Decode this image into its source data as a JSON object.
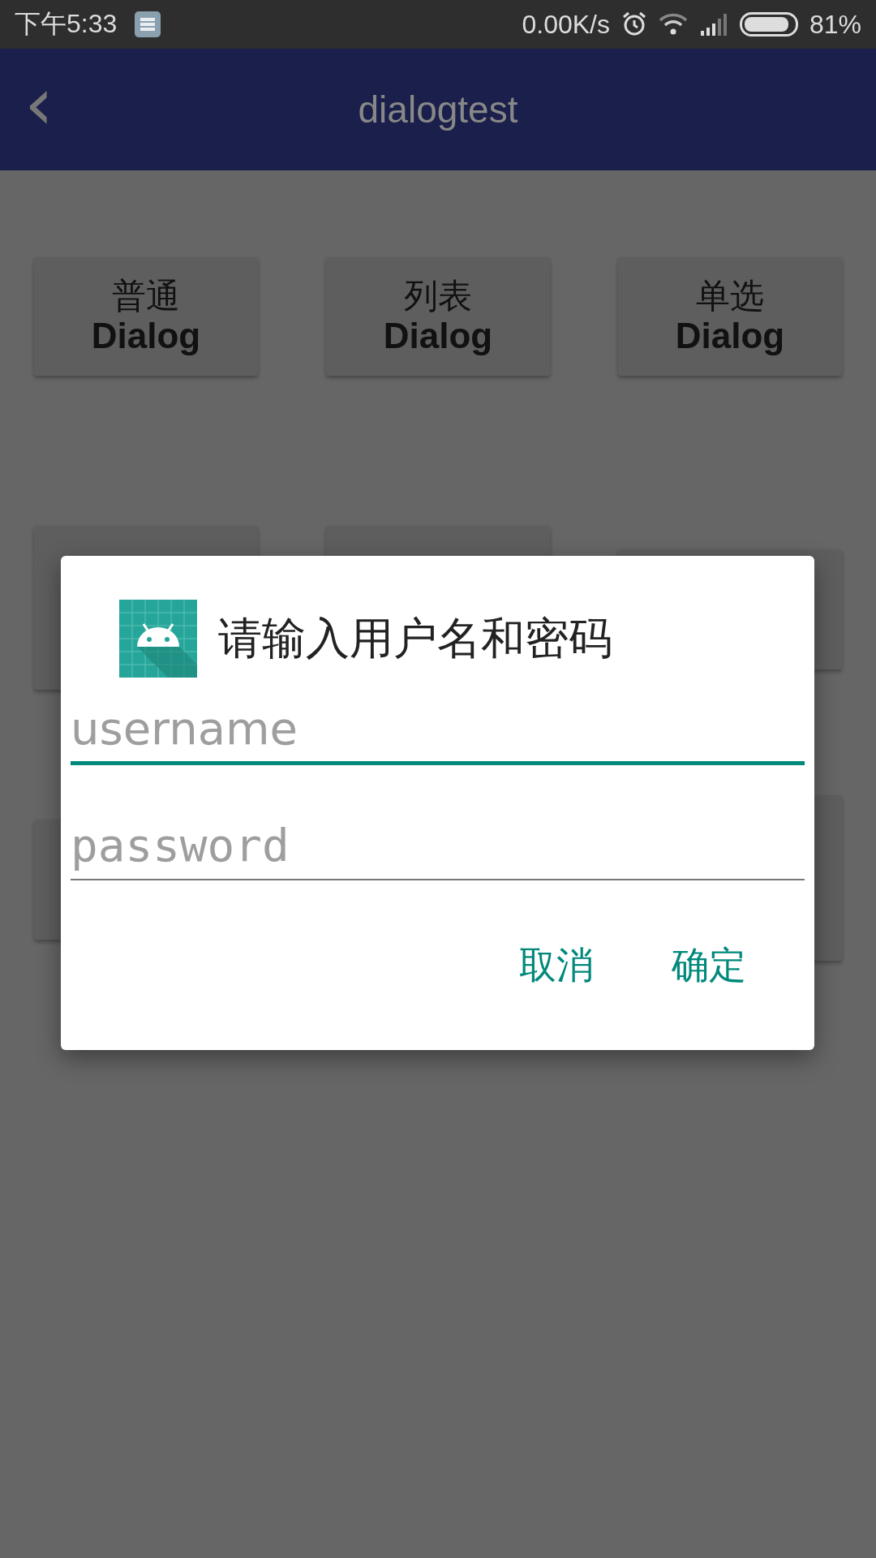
{
  "status_bar": {
    "time": "下午5:33",
    "speed": "0.00K/s",
    "battery": "81%"
  },
  "app_bar": {
    "back": "‹",
    "title": "dialogtest"
  },
  "buttons": [
    {
      "line1": "普通",
      "line2": "Dialog"
    },
    {
      "line1": "列表",
      "line2": "Dialog"
    },
    {
      "line1": "单选",
      "line2": "Dialog"
    }
  ],
  "dialog": {
    "title": "请输入用户名和密码",
    "fields": [
      {
        "placeholder": "username",
        "kind": "text",
        "focused": true
      },
      {
        "placeholder": "password",
        "kind": "password",
        "focused": false
      }
    ],
    "actions": [
      "取消",
      "确定"
    ]
  }
}
